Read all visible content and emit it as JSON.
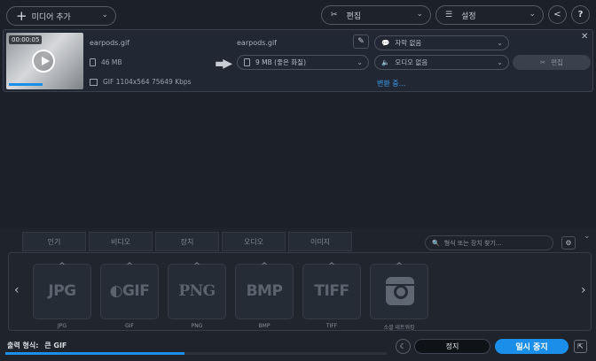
{
  "toolbar": {
    "add_media": "미디어 추가",
    "edit": "편집",
    "settings": "설정"
  },
  "file": {
    "thumb_time": "00:00:05",
    "thumb_progress": 0.47,
    "source_name": "earpods.gif",
    "source_size": "46 MB",
    "source_info": "GIF 1104x564 75649 Kbps",
    "target_name": "earpods.gif",
    "target_size": "9 MB (좋은 화질)",
    "subtitle": "자막 없음",
    "audio": "오디오 없음",
    "edit": "편집",
    "status": "변환 중..."
  },
  "panel": {
    "tabs": [
      "인기",
      "비디오",
      "장치",
      "오디오",
      "이미지"
    ],
    "search_placeholder": "형식 또는 장치 찾기...",
    "formats": [
      {
        "logo": "JPG",
        "label": "JPG"
      },
      {
        "logo": "GIF",
        "label": "GIF"
      },
      {
        "logo": "PNG",
        "label": "PNG"
      },
      {
        "logo": "BMP",
        "label": "BMP"
      },
      {
        "logo": "TIFF",
        "label": "TIFF"
      },
      {
        "logo": "",
        "label": "소셜 네트워킹"
      }
    ]
  },
  "footer": {
    "output_label": "출력 형식:",
    "output_value": "큰 GIF",
    "progress": 0.47,
    "stop": "정지",
    "pause": "일시 중지"
  }
}
